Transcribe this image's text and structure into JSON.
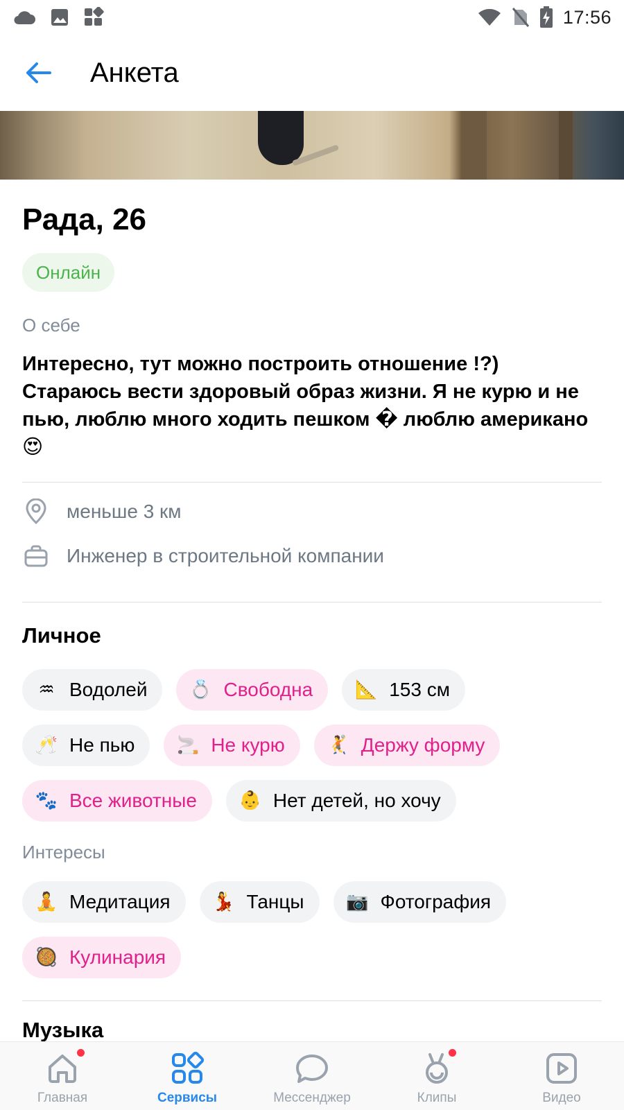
{
  "status_bar": {
    "time": "17:56",
    "left_icons": [
      "cloud-icon",
      "image-icon",
      "apps-icon"
    ],
    "right_icons": [
      "wifi-icon",
      "no-sim-icon",
      "battery-charging-icon"
    ]
  },
  "header": {
    "title": "Анкета",
    "back_icon": "arrow-left-icon"
  },
  "profile": {
    "name_age": "Рада, 26",
    "online": "Онлайн",
    "about_label": "О себе",
    "about_text": "Интересно, тут можно построить отношение !?) Стараюсь вести здоровый образ жизни. Я не курю и не пью, люблю много ходить пешком � люблю американо 😍",
    "distance": "меньше 3 км",
    "job": "Инженер в строительной компании"
  },
  "personal": {
    "title": "Личное",
    "chips": [
      {
        "emoji": "♒",
        "label": "Водолей",
        "highlight": false
      },
      {
        "emoji": "💍",
        "label": "Свободна",
        "highlight": true
      },
      {
        "emoji": "📐",
        "label": "153 см",
        "highlight": false
      },
      {
        "emoji": "🥂",
        "label": "Не пью",
        "highlight": false
      },
      {
        "emoji": "🚬",
        "label": "Не курю",
        "highlight": true
      },
      {
        "emoji": "🤾",
        "label": "Держу форму",
        "highlight": true
      },
      {
        "emoji": "🐾",
        "label": "Все животные",
        "highlight": true
      },
      {
        "emoji": "👶",
        "label": "Нет детей, но хочу",
        "highlight": false
      }
    ]
  },
  "interests": {
    "label": "Интересы",
    "chips": [
      {
        "emoji": "🧘",
        "label": "Медитация",
        "highlight": false
      },
      {
        "emoji": "💃",
        "label": "Танцы",
        "highlight": false
      },
      {
        "emoji": "📷",
        "label": "Фотография",
        "highlight": false
      },
      {
        "emoji": "🥘",
        "label": "Кулинария",
        "highlight": true
      }
    ]
  },
  "music": {
    "title": "Музыка"
  },
  "tabbar": {
    "items": [
      {
        "label": "Главная",
        "icon": "home-icon",
        "active": false,
        "badge": true
      },
      {
        "label": "Сервисы",
        "icon": "services-icon",
        "active": true,
        "badge": false
      },
      {
        "label": "Мессенджер",
        "icon": "messenger-icon",
        "active": false,
        "badge": false
      },
      {
        "label": "Клипы",
        "icon": "clips-icon",
        "active": false,
        "badge": true
      },
      {
        "label": "Видео",
        "icon": "video-icon",
        "active": false,
        "badge": false
      }
    ]
  },
  "colors": {
    "accent": "#2688eb",
    "online_green": "#4bb34b",
    "highlight_pink": "#e0218a",
    "badge_red": "#ff3347"
  }
}
